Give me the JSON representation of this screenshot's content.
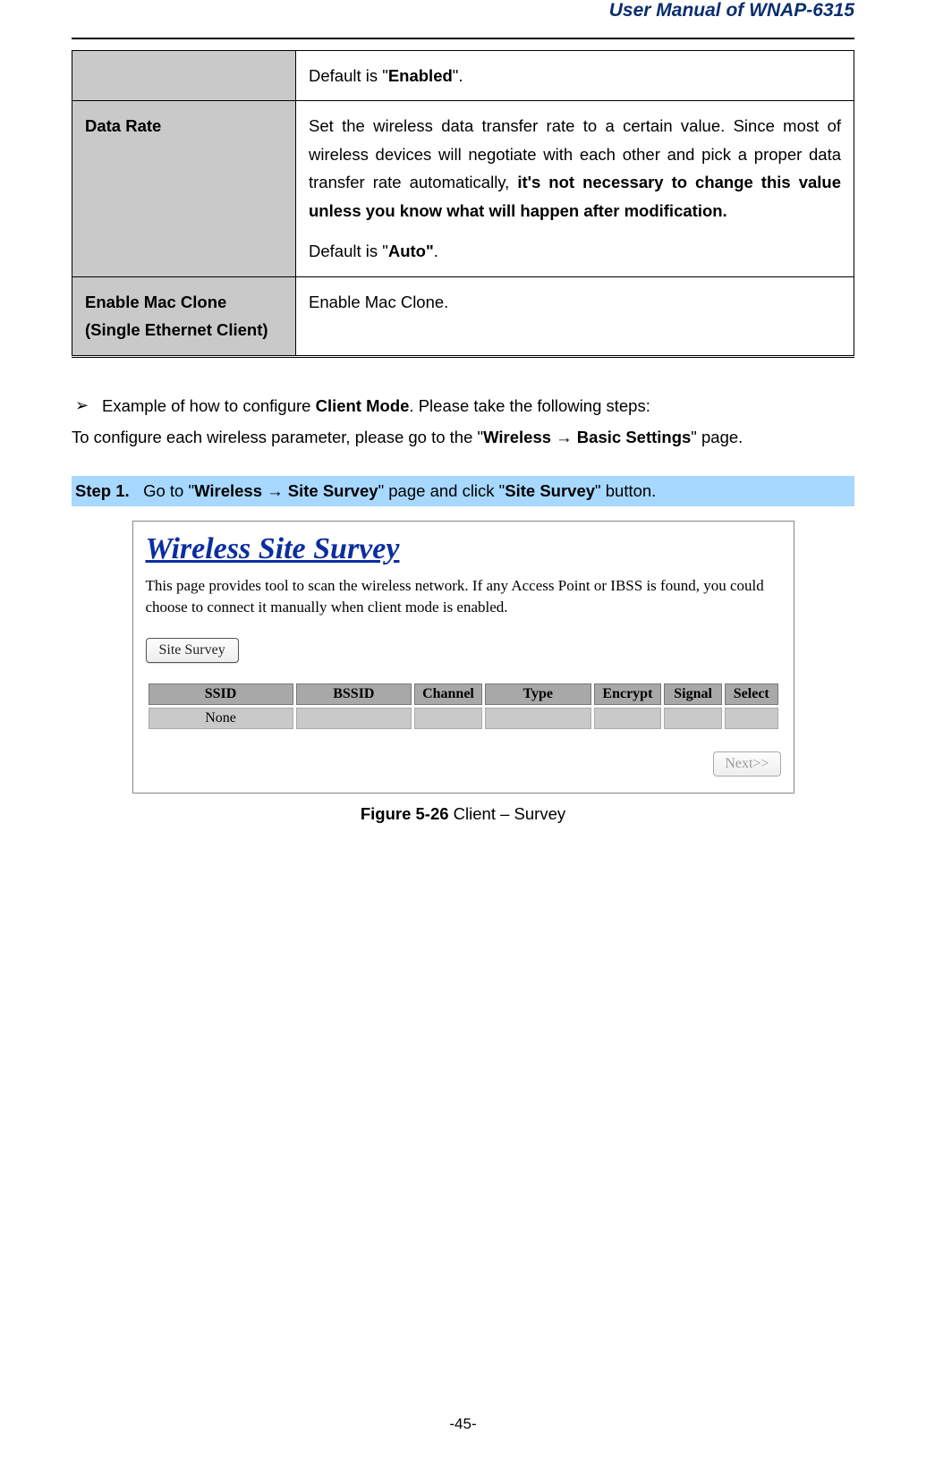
{
  "header": {
    "title": "User Manual of WNAP-6315"
  },
  "table": {
    "rows": [
      {
        "label": "",
        "desc_pre": "Default is \"",
        "desc_bold": "Enabled",
        "desc_post": "\"."
      },
      {
        "label": "Data Rate",
        "p1_pre": "Set the wireless data transfer rate to a certain value. Since most of wireless devices will negotiate with each other and pick a proper data transfer rate automatically, ",
        "p1_bold": "it's not necessary to change this value unless you know what will happen after modification.",
        "p2_pre": "Default is \"",
        "p2_bold": "Auto\"",
        "p2_post": "."
      },
      {
        "label": "Enable Mac Clone (Single Ethernet Client)",
        "desc": "Enable Mac Clone."
      }
    ]
  },
  "bullet": {
    "line1_pre": "Example of how to configure ",
    "line1_bold": "Client Mode",
    "line1_post": ". Please take the following steps:",
    "line2_pre": "To configure each wireless parameter, please go to the \"",
    "line2_bold": "Wireless → Basic Settings",
    "line2_post": "\" page."
  },
  "step": {
    "label": "Step 1.",
    "pre": "Go to \"",
    "bold1": "Wireless → Site Survey",
    "mid": "\" page and click \"",
    "bold2": "Site Survey",
    "post": "\" button."
  },
  "screenshot": {
    "title": "Wireless Site Survey",
    "desc": "This page provides tool to scan the wireless network. If any Access Point or IBSS is found, you could choose to connect it manually when client mode is enabled.",
    "button": "Site Survey",
    "headers": [
      "SSID",
      "BSSID",
      "Channel",
      "Type",
      "Encrypt",
      "Signal",
      "Select"
    ],
    "row": {
      "ssid": "None",
      "bssid": "",
      "channel": "",
      "type": "",
      "encrypt": "",
      "signal": "",
      "select": ""
    },
    "next": "Next>>"
  },
  "figure": {
    "label": "Figure 5-26",
    "caption": " Client – Survey"
  },
  "footer": {
    "page": "-45-"
  }
}
